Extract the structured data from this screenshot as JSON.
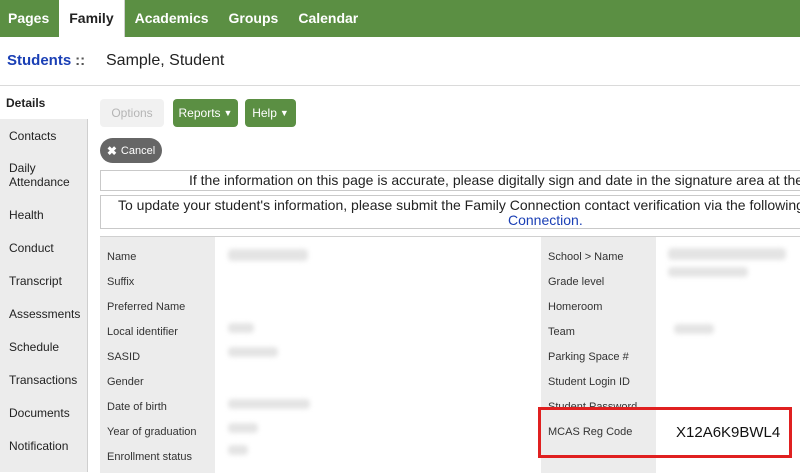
{
  "topnav": {
    "tabs": [
      {
        "label": "Pages"
      },
      {
        "label": "Family",
        "active": true
      },
      {
        "label": "Academics"
      },
      {
        "label": "Groups"
      },
      {
        "label": "Calendar"
      }
    ]
  },
  "header": {
    "breadcrumb": "Students",
    "separator": "::",
    "student_name": "Sample, Student"
  },
  "sidebar": {
    "items": [
      {
        "label": "Details",
        "active": true
      },
      {
        "label": "Contacts"
      },
      {
        "label": "Daily Attendance"
      },
      {
        "label": "Health"
      },
      {
        "label": "Conduct"
      },
      {
        "label": "Transcript"
      },
      {
        "label": "Assessments"
      },
      {
        "label": "Schedule"
      },
      {
        "label": "Transactions"
      },
      {
        "label": "Documents"
      },
      {
        "label": "Notification"
      }
    ]
  },
  "toolbar": {
    "options_label": "Options",
    "reports_label": "Reports",
    "help_label": "Help",
    "cancel_label": "Cancel"
  },
  "notices": {
    "sign_notice": "If the information on this page is accurate, please digitally sign and date in the signature area at the bot",
    "update_notice": "To update your student's information, please submit the Family Connection contact verification via the following link",
    "link_text": "Connection."
  },
  "fields_left": [
    {
      "label": "Name"
    },
    {
      "label": "Suffix"
    },
    {
      "label": "Preferred Name"
    },
    {
      "label": "Local identifier"
    },
    {
      "label": "SASID"
    },
    {
      "label": "Gender"
    },
    {
      "label": "Date of birth"
    },
    {
      "label": "Year of graduation"
    },
    {
      "label": "Enrollment status"
    }
  ],
  "fields_right": [
    {
      "label": "School > Name"
    },
    {
      "label": "Grade level"
    },
    {
      "label": "Homeroom"
    },
    {
      "label": "Team"
    },
    {
      "label": "Parking Space #"
    },
    {
      "label": "Student Login ID"
    },
    {
      "label": "Student Password"
    },
    {
      "label": "MCAS Reg Code",
      "value": "X12A6K9BWL4"
    }
  ],
  "colors": {
    "nav_green": "#5b8f43",
    "link_blue": "#1a3fb5",
    "highlight_red": "#e02020"
  }
}
